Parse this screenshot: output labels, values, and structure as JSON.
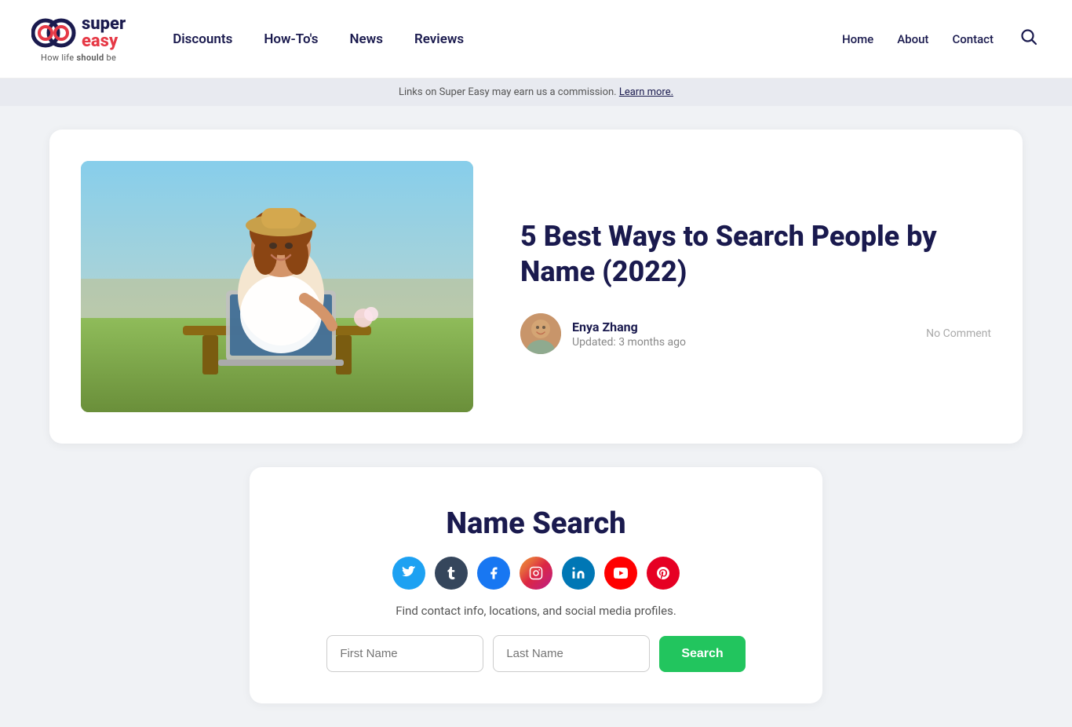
{
  "header": {
    "logo": {
      "super": "super",
      "easy": "easy",
      "tagline": "How life should be"
    },
    "nav": {
      "items": [
        {
          "label": "Discounts",
          "href": "#"
        },
        {
          "label": "How-To's",
          "href": "#"
        },
        {
          "label": "News",
          "href": "#"
        },
        {
          "label": "Reviews",
          "href": "#"
        }
      ]
    },
    "right_nav": {
      "items": [
        {
          "label": "Home",
          "href": "#"
        },
        {
          "label": "About",
          "href": "#"
        },
        {
          "label": "Contact",
          "href": "#"
        }
      ]
    }
  },
  "affiliate_banner": {
    "text": "Links on Super Easy may earn us a commission.",
    "link_text": "Learn more."
  },
  "article": {
    "title": "5 Best Ways to Search People by Name (2022)",
    "author": {
      "name": "Enya Zhang",
      "updated": "Updated: 3 months ago"
    },
    "no_comment": "No Comment"
  },
  "name_search": {
    "title": "Name Search",
    "description": "Find contact info, locations, and social media profiles.",
    "first_name_placeholder": "First Name",
    "last_name_placeholder": "Last Name",
    "search_button_label": "Search"
  },
  "social_icons": [
    {
      "name": "twitter",
      "class": "si-twitter",
      "symbol": "𝕏"
    },
    {
      "name": "tumblr",
      "class": "si-tumblr",
      "symbol": "t"
    },
    {
      "name": "facebook",
      "class": "si-facebook",
      "symbol": "f"
    },
    {
      "name": "instagram",
      "class": "si-instagram",
      "symbol": "📷"
    },
    {
      "name": "linkedin",
      "class": "si-linkedin",
      "symbol": "in"
    },
    {
      "name": "youtube",
      "class": "si-youtube",
      "symbol": "▶"
    },
    {
      "name": "pinterest",
      "class": "si-pinterest",
      "symbol": "P"
    }
  ]
}
